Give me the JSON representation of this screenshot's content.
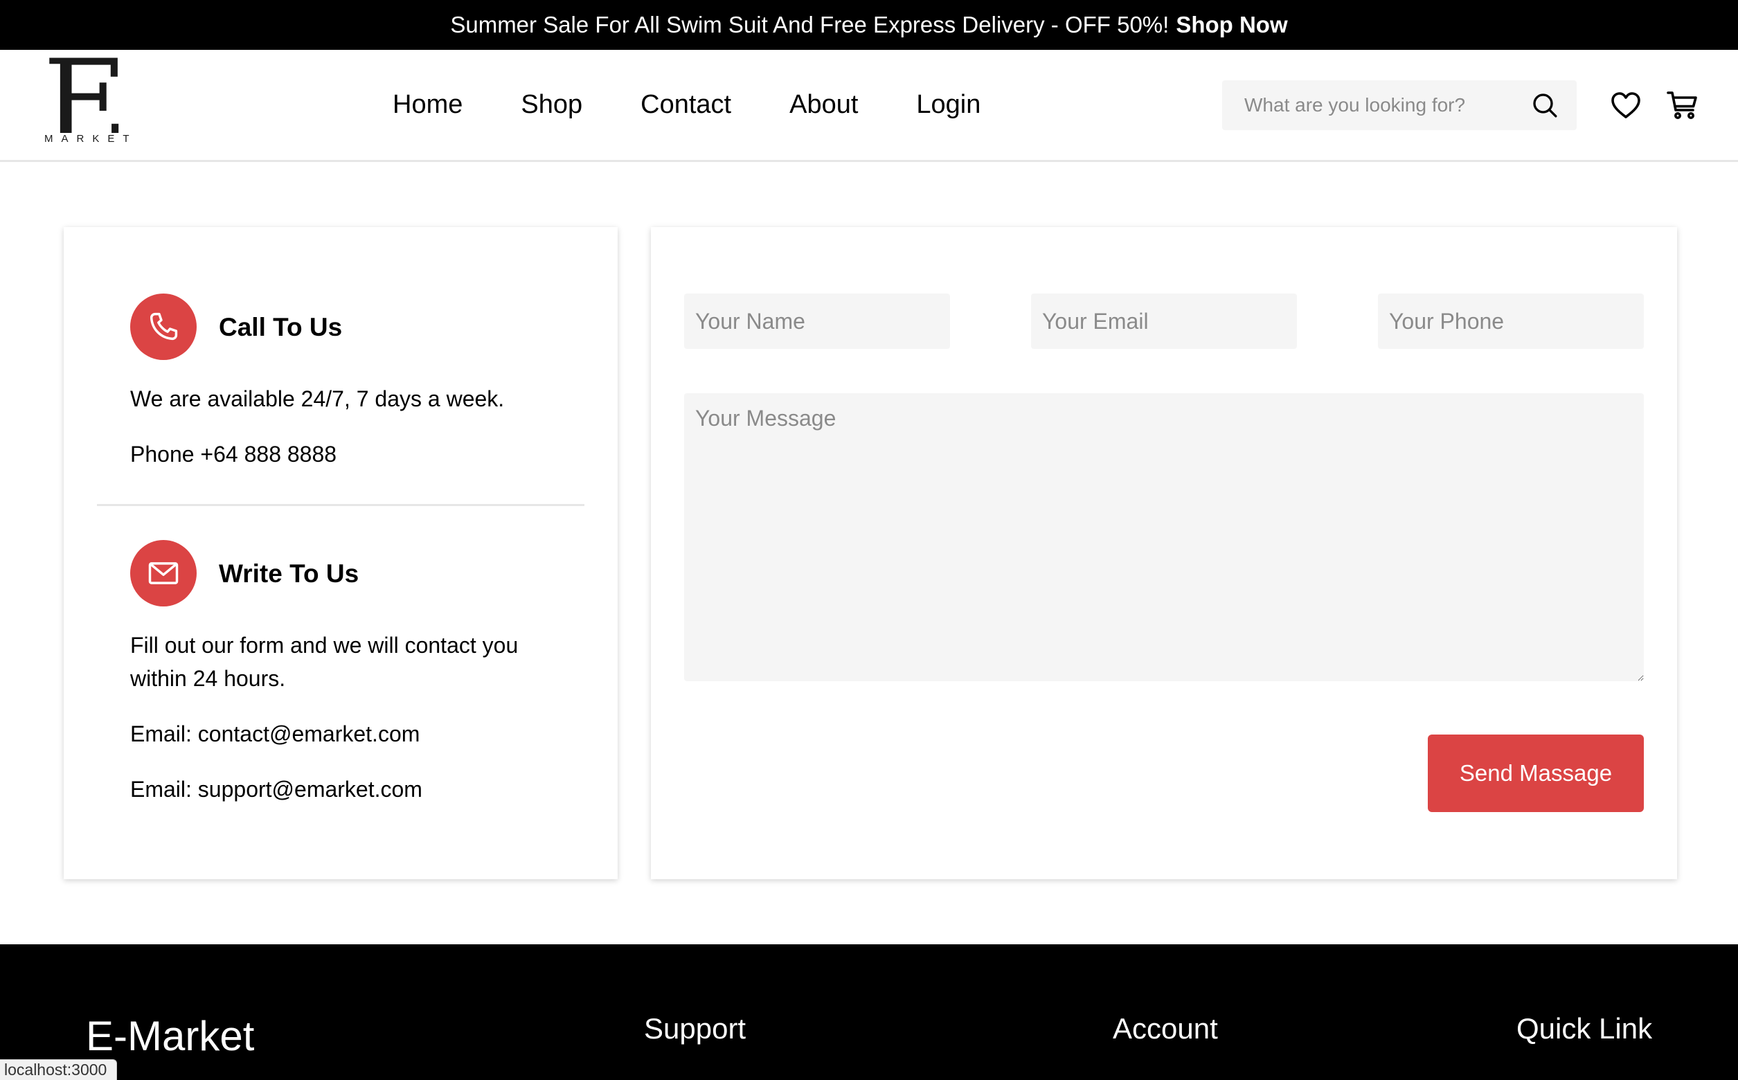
{
  "promo": {
    "text": "Summer Sale For All Swim Suit And Free Express Delivery - OFF 50%!",
    "link": "Shop Now"
  },
  "header": {
    "logo_letter": "E",
    "logo_word": "MARKET",
    "nav": [
      "Home",
      "Shop",
      "Contact",
      "About",
      "Login"
    ],
    "search_placeholder": "What are you looking for?",
    "icons": [
      "search-icon",
      "heart-icon",
      "cart-icon"
    ]
  },
  "contact": {
    "call": {
      "title": "Call To Us",
      "availability": "We are available 24/7, 7 days a week.",
      "phone": "Phone +64 888 8888"
    },
    "write": {
      "title": "Write To Us",
      "description": "Fill out our form and we will contact you within 24 hours.",
      "email1": "Email: contact@emarket.com",
      "email2": "Email: support@emarket.com"
    }
  },
  "form": {
    "name_placeholder": "Your Name",
    "email_placeholder": "Your Email",
    "phone_placeholder": "Your Phone",
    "message_placeholder": "Your Message",
    "submit_label": "Send Massage"
  },
  "footer": {
    "brand": "E-Market",
    "columns": [
      "Support",
      "Account",
      "Quick Link"
    ]
  },
  "status_url": "localhost:3000",
  "colors": {
    "accent": "#db4444",
    "promo_bg": "#000000",
    "input_bg": "#f5f5f5"
  }
}
